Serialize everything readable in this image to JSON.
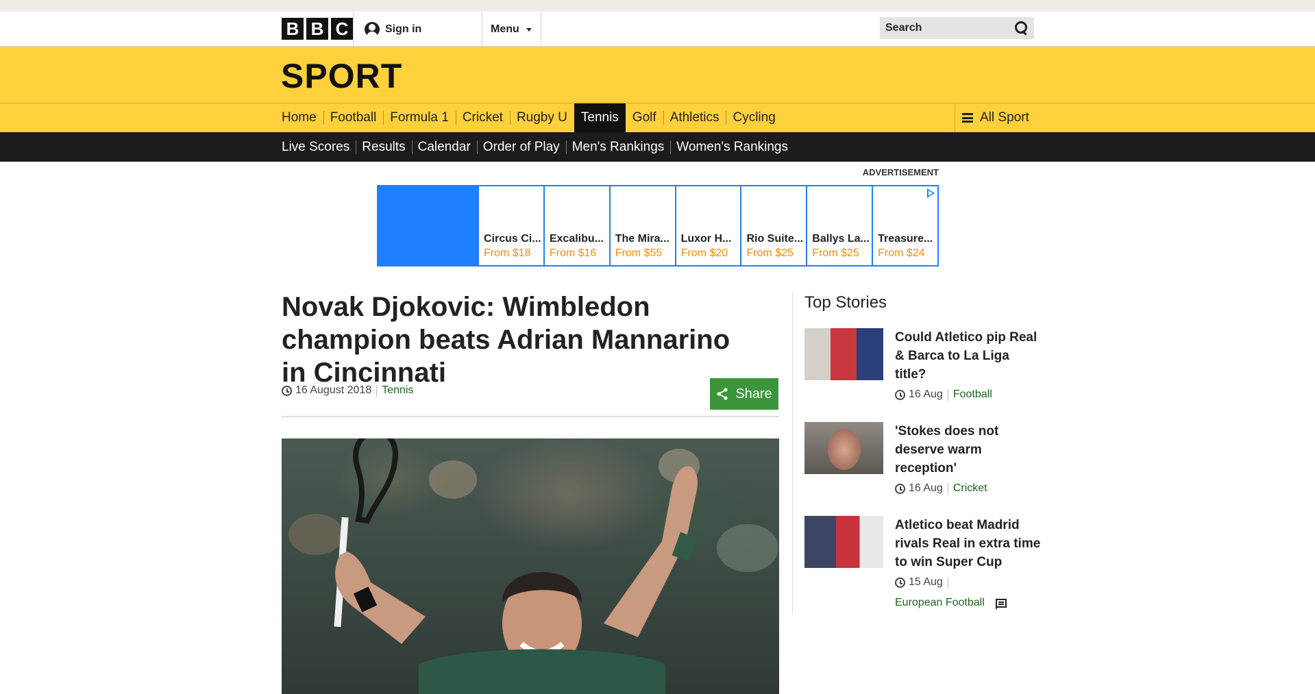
{
  "masthead": {
    "logo_letters": [
      "B",
      "B",
      "C"
    ],
    "signin_label": "Sign in",
    "menu_label": "Menu",
    "search_placeholder": "Search"
  },
  "sport_title": "SPORT",
  "primary_nav": [
    {
      "label": "Home"
    },
    {
      "label": "Football"
    },
    {
      "label": "Formula 1"
    },
    {
      "label": "Cricket"
    },
    {
      "label": "Rugby U"
    },
    {
      "label": "Tennis",
      "active": true
    },
    {
      "label": "Golf"
    },
    {
      "label": "Athletics"
    },
    {
      "label": "Cycling"
    }
  ],
  "all_sport_label": "All Sport",
  "secondary_nav": [
    "Live Scores",
    "Results",
    "Calendar",
    "Order of Play",
    "Men's Rankings",
    "Women's Rankings"
  ],
  "advert": {
    "label": "ADVERTISEMENT",
    "tiles": [
      {
        "name": "Circus Ci...",
        "price": "From $18"
      },
      {
        "name": "Excalibu...",
        "price": "From $16"
      },
      {
        "name": "The Mira...",
        "price": "From $55"
      },
      {
        "name": "Luxor H...",
        "price": "From $20"
      },
      {
        "name": "Rio Suite...",
        "price": "From $25"
      },
      {
        "name": "Ballys La...",
        "price": "From $25"
      },
      {
        "name": "Treasure...",
        "price": "From $24"
      }
    ]
  },
  "article": {
    "headline": "Novak Djokovic: Wimbledon champion beats Adrian Mannarino in Cincinnati",
    "date": "16 August 2018",
    "section": "Tennis",
    "share_label": "Share"
  },
  "sidebar": {
    "title": "Top Stories",
    "stories": [
      {
        "title": "Could Atletico pip Real & Barca to La Liga title?",
        "date": "16 Aug",
        "section": "Football"
      },
      {
        "title": "'Stokes does not deserve warm reception'",
        "date": "16 Aug",
        "section": "Cricket"
      },
      {
        "title": "Atletico beat Madrid rivals Real in extra time to win Super Cup",
        "date": "15 Aug",
        "section": "European Football",
        "has_comments": true
      }
    ]
  },
  "colors": {
    "sport_yellow": "#fed03b",
    "nav_black": "#1c1c1c",
    "share_green": "#3b963b",
    "link_green": "#1a6321",
    "ad_blue": "#1f80ff",
    "ad_price_orange": "#ff8a00"
  }
}
